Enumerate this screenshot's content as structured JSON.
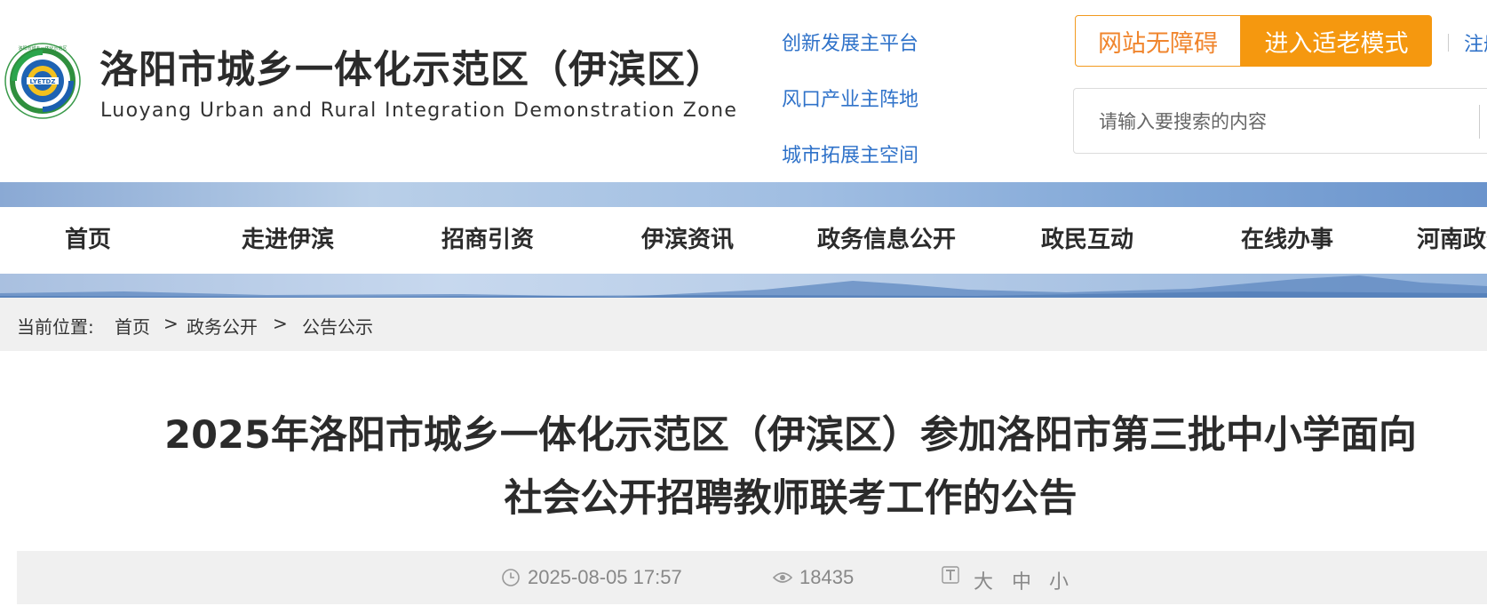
{
  "header": {
    "logo_name": "luoyang-integration-zone-emblem",
    "logo_text": "洛阳市城乡一体化示范区",
    "title": "洛阳市城乡一体化示范区（伊滨区）",
    "subtitle": "Luoyang Urban and Rural Integration Demonstration Zone",
    "slogans": [
      "创新发展主平台",
      "风口产业主阵地",
      "城市拓展主空间"
    ],
    "accessibility_label": "网站无障碍",
    "elder_mode_label": "进入适老模式",
    "register_label": "注册",
    "search_placeholder": "请输入要搜索的内容"
  },
  "nav": {
    "items": [
      "首页",
      "走进伊滨",
      "招商引资",
      "伊滨资讯",
      "政务信息公开",
      "政民互动",
      "在线办事",
      "河南政务"
    ]
  },
  "breadcrumb": {
    "prefix": "当前位置:",
    "items": [
      "首页",
      "政务公开",
      "公告公示"
    ],
    "separator": ">"
  },
  "article": {
    "title_line1": "2025年洛阳市城乡一体化示范区（伊滨区）参加洛阳市第三批中小学面向",
    "title_line2": "社会公开招聘教师联考工作的公告",
    "date": "2025-08-05 17:57",
    "views": "18435",
    "font_sizes": [
      "大",
      "中",
      "小"
    ],
    "icons": {
      "date": "clock-icon",
      "views": "eye-icon",
      "font": "text-size-icon"
    }
  },
  "colors": {
    "link_blue": "#2f72c9",
    "accent_orange": "#f5980f",
    "nav_text": "#2b2b2b",
    "breadcrumb_bg": "#f0f0f0"
  }
}
